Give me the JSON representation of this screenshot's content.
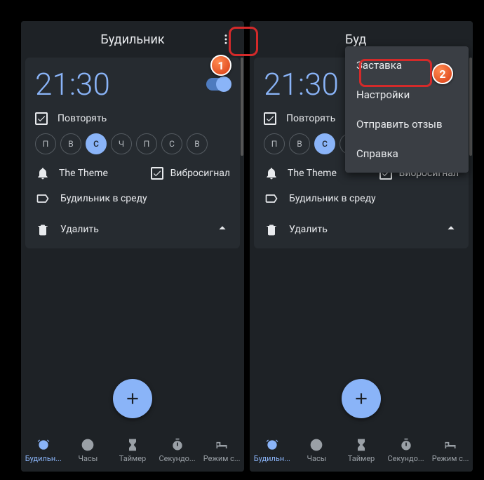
{
  "header_title": "Будильник",
  "header_title_right": "Буд",
  "alarm": {
    "time": "21:30",
    "repeat": "Повторять",
    "days": [
      "П",
      "В",
      "С",
      "Ч",
      "П",
      "С",
      "В"
    ],
    "active_day_index": 2,
    "ringtone": "The Theme",
    "vibrate": "Вибросигнал",
    "label": "Будильник в среду",
    "delete": "Удалить"
  },
  "nav": [
    {
      "label": "Будильн..."
    },
    {
      "label": "Часы"
    },
    {
      "label": "Таймер"
    },
    {
      "label": "Секундо..."
    },
    {
      "label": "Режим с..."
    }
  ],
  "menu": [
    {
      "label": "Заставка"
    },
    {
      "label": "Настройки"
    },
    {
      "label": "Отправить отзыв"
    },
    {
      "label": "Справка"
    }
  ],
  "badges": {
    "one": "1",
    "two": "2"
  }
}
